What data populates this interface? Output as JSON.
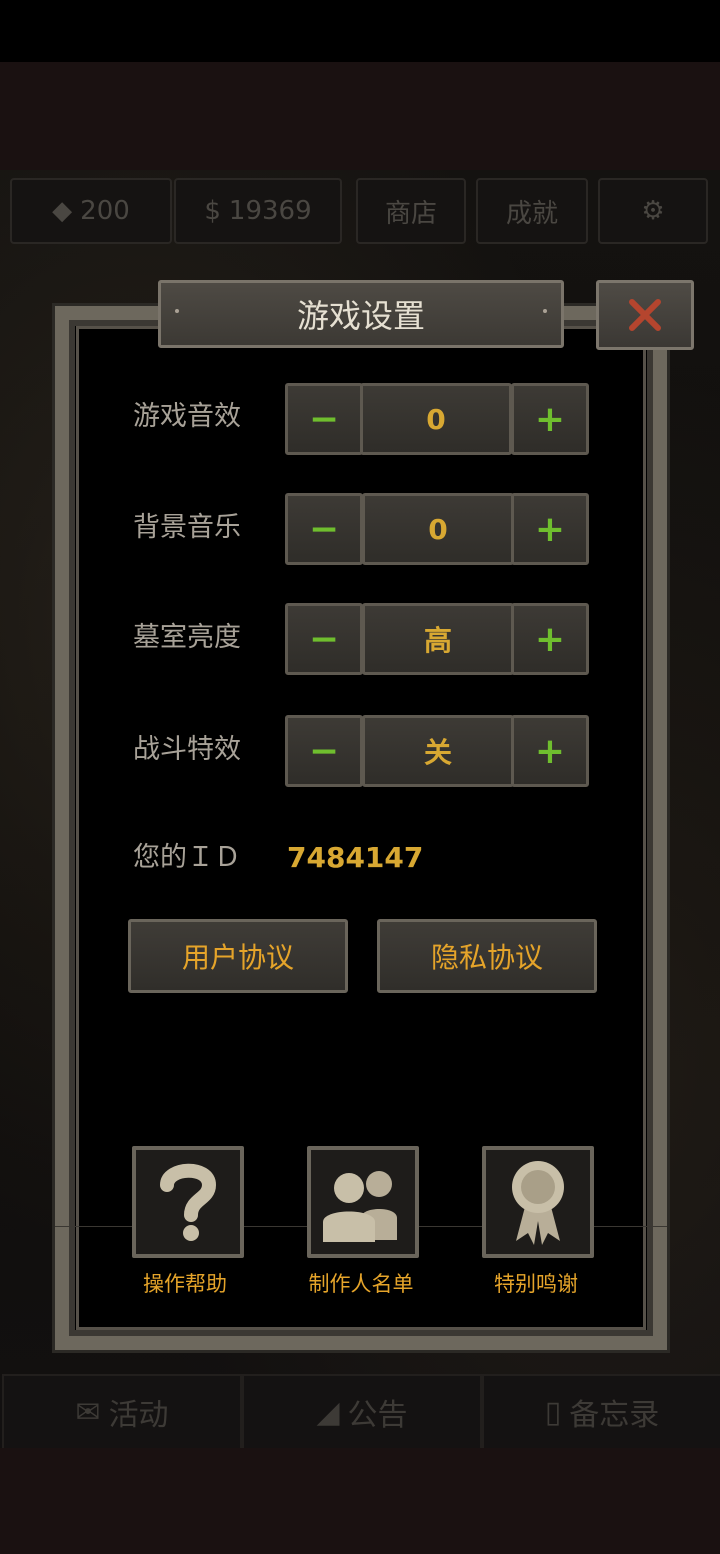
{
  "hud": {
    "gems": "200",
    "coins": "19369",
    "shop_label": "商店",
    "achievements_label": "成就"
  },
  "bottom_tabs": [
    {
      "label": "活动",
      "icon": "envelope-icon"
    },
    {
      "label": "公告",
      "icon": "megaphone-icon"
    },
    {
      "label": "备忘录",
      "icon": "notepad-icon"
    }
  ],
  "dialog": {
    "title": "游戏设置",
    "close_icon": "close-icon"
  },
  "settings": [
    {
      "label": "游戏音效",
      "value": "0",
      "minus": "−",
      "plus": "+"
    },
    {
      "label": "背景音乐",
      "value": "0",
      "minus": "−",
      "plus": "+"
    },
    {
      "label": "墓室亮度",
      "value": "高",
      "minus": "−",
      "plus": "+"
    },
    {
      "label": "战斗特效",
      "value": "关",
      "minus": "−",
      "plus": "+"
    }
  ],
  "user_id": {
    "label": "您的ＩＤ",
    "value": "7484147"
  },
  "agreements": {
    "user_agreement": "用户协议",
    "privacy_agreement": "隐私协议"
  },
  "footer_tiles": [
    {
      "label": "操作帮助",
      "icon": "question-icon"
    },
    {
      "label": "制作人名单",
      "icon": "people-icon"
    },
    {
      "label": "特别鸣谢",
      "icon": "award-ribbon-icon"
    }
  ],
  "colors": {
    "accent_gold": "#d8a832",
    "accent_green": "#6fbe2e",
    "close_red": "#b5452e"
  }
}
